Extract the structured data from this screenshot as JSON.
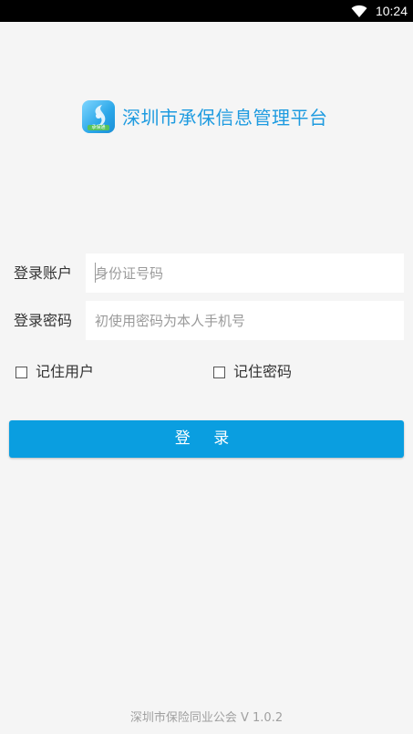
{
  "status_bar": {
    "time": "10:24",
    "wifi_icon": "wifi-icon"
  },
  "brand": {
    "title": "深圳市承保信息管理平台",
    "logo_text": "承保通",
    "logo_icon": "app-logo"
  },
  "login_form": {
    "account": {
      "label": "登录账户",
      "placeholder": "身份证号码",
      "value": ""
    },
    "password": {
      "label": "登录密码",
      "placeholder": "初使用密码为本人手机号",
      "value": ""
    }
  },
  "options": {
    "remember_user": {
      "label": "记住用户",
      "checked": false
    },
    "remember_password": {
      "label": "记住密码",
      "checked": false
    }
  },
  "login_button": {
    "label": "登 录"
  },
  "footer": {
    "text": "深圳市保险同业公会  V 1.0.2"
  },
  "colors": {
    "accent": "#0a9ee0",
    "brand_text": "#1e9be0",
    "background": "#f5f5f5"
  }
}
